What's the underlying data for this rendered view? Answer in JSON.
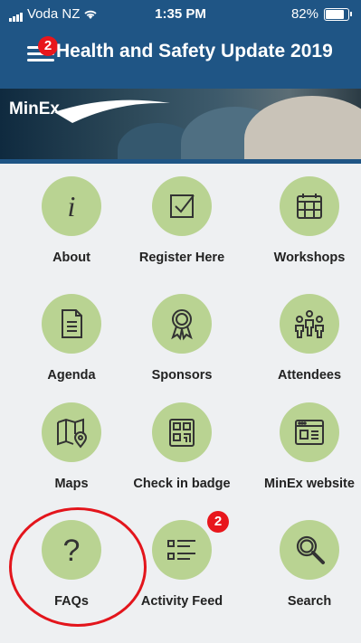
{
  "status_bar": {
    "carrier": "Voda NZ",
    "time": "1:35 PM",
    "battery": "82%"
  },
  "header": {
    "title": "Health and Safety Update 2019",
    "menu_badge": "2"
  },
  "banner": {
    "logo": "MinEx"
  },
  "tiles": [
    {
      "label": "About",
      "icon": "info-icon"
    },
    {
      "label": "Register Here",
      "icon": "checkbox-icon"
    },
    {
      "label": "Workshops",
      "icon": "calendar-icon"
    },
    {
      "label": "Agenda",
      "icon": "document-icon"
    },
    {
      "label": "Sponsors",
      "icon": "ribbon-icon"
    },
    {
      "label": "Attendees",
      "icon": "people-icon"
    },
    {
      "label": "Maps",
      "icon": "map-icon"
    },
    {
      "label": "Check in badge",
      "icon": "qr-code-icon"
    },
    {
      "label": "MinEx website",
      "icon": "browser-icon"
    },
    {
      "label": "FAQs",
      "icon": "question-icon"
    },
    {
      "label": "Activity Feed",
      "icon": "list-icon",
      "badge": "2"
    },
    {
      "label": "Search",
      "icon": "search-icon"
    }
  ],
  "colors": {
    "header": "#1f5585",
    "tile_circle": "#b9d392",
    "badge": "#e8161c",
    "highlight_ring": "#e3151c"
  }
}
